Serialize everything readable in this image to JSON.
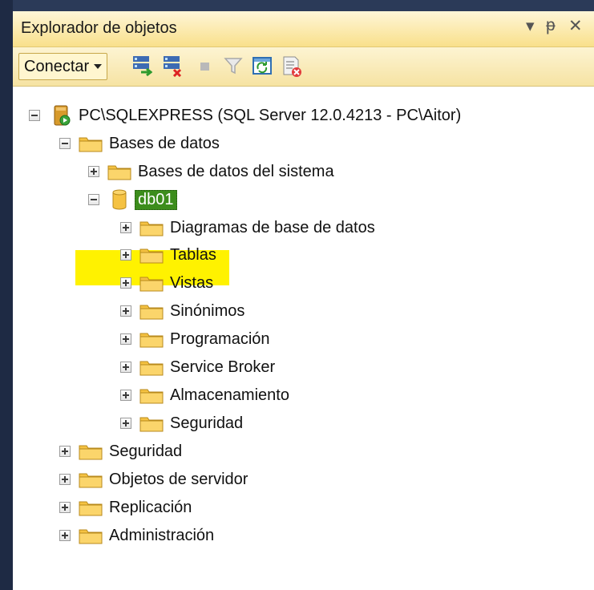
{
  "panel": {
    "title": "Explorador de objetos",
    "pin_glyph": "▾ ᵽ",
    "close_glyph": "✕"
  },
  "toolbar": {
    "connect_label": "Conectar",
    "icons": [
      "connect-object-explorer-icon",
      "disconnect-icon",
      "stop-icon",
      "filter-icon",
      "refresh-icon",
      "activity-monitor-icon"
    ]
  },
  "tree": {
    "server": "PC\\SQLEXPRESS (SQL Server 12.0.4213 - PC\\Aitor)",
    "databases": "Bases de datos",
    "system_databases": "Bases de datos del sistema",
    "db01": "db01",
    "db_children": [
      "Diagramas de base de datos",
      "Tablas",
      "Vistas",
      "Sinónimos",
      "Programación",
      "Service Broker",
      "Almacenamiento",
      "Seguridad"
    ],
    "server_children": [
      "Seguridad",
      "Objetos de servidor",
      "Replicación",
      "Administración"
    ]
  },
  "colors": {
    "highlight": "#fff200",
    "selection": "#3c8d1c",
    "folder": "#f5c242"
  }
}
